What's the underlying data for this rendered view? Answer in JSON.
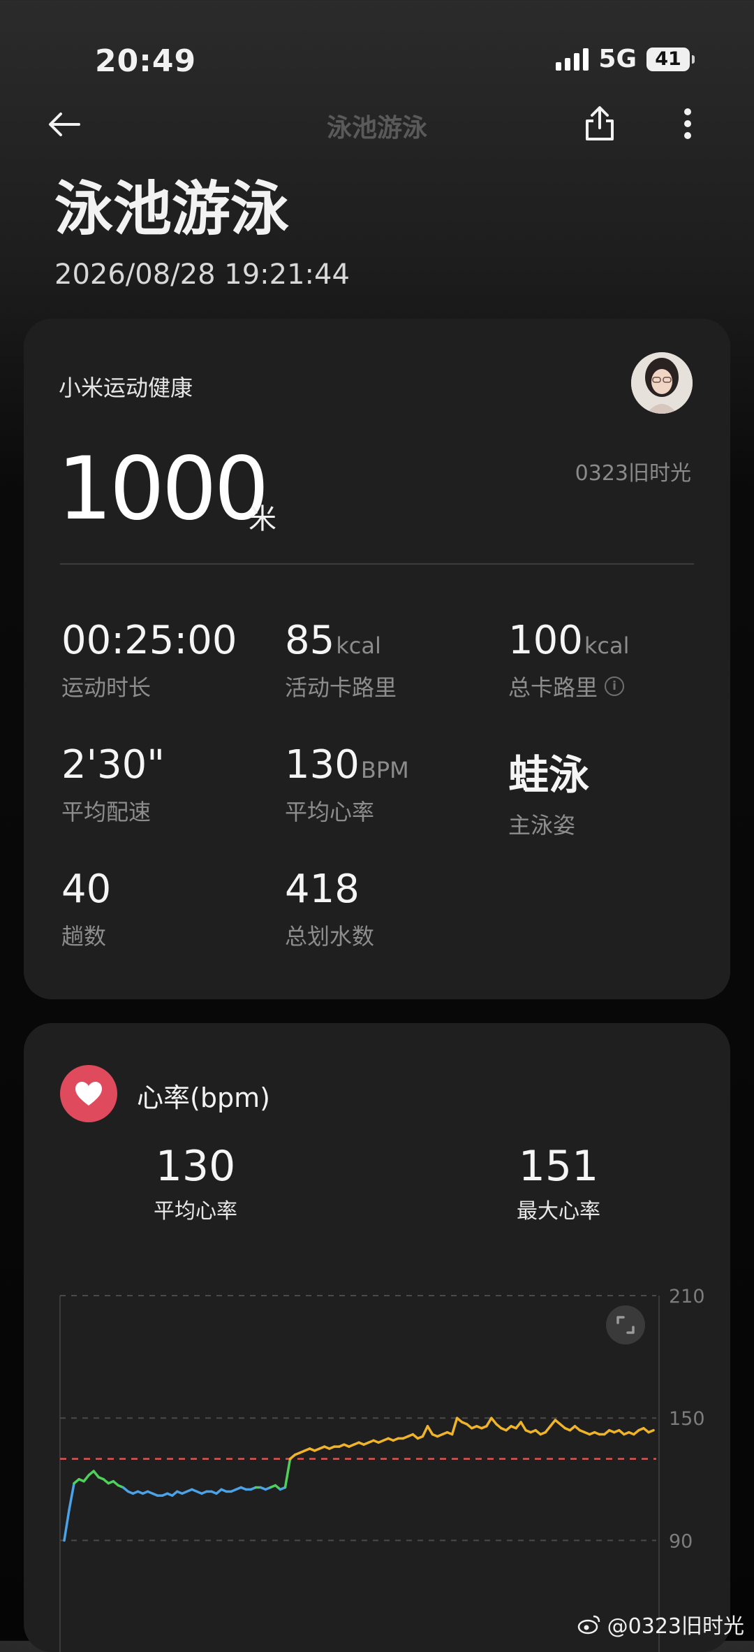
{
  "status_bar": {
    "time": "20:49",
    "network": "5G",
    "battery": "41"
  },
  "toolbar": {
    "title": "泳池游泳"
  },
  "header": {
    "title": "泳池游泳",
    "datetime": "2026/08/28 19:21:44"
  },
  "summary": {
    "app_name": "小米运动健康",
    "distance": "1000",
    "distance_unit": "米",
    "watermark": "0323旧时光",
    "stats": [
      {
        "value": "00:25:00",
        "unit": "",
        "label": "运动时长"
      },
      {
        "value": "85",
        "unit": "kcal",
        "label": "活动卡路里"
      },
      {
        "value": "100",
        "unit": "kcal",
        "label": "总卡路里",
        "info": true
      },
      {
        "value": "2'30\"",
        "unit": "",
        "label": "平均配速"
      },
      {
        "value": "130",
        "unit": "BPM",
        "label": "平均心率"
      },
      {
        "value": "蛙泳",
        "unit": "",
        "label": "主泳姿"
      },
      {
        "value": "40",
        "unit": "",
        "label": "趟数"
      },
      {
        "value": "418",
        "unit": "",
        "label": "总划水数"
      }
    ]
  },
  "heart_rate": {
    "title": "心率(bpm)",
    "avg_value": "130",
    "avg_label": "平均心率",
    "max_value": "151",
    "max_label": "最大心率"
  },
  "chart_data": {
    "type": "line",
    "title": "",
    "ylabel": "",
    "ylim": [
      70,
      210
    ],
    "yticks": [
      "210",
      "150",
      "90"
    ],
    "reference_line": 130,
    "grid": "dashed horizontal at 210, 150, 90",
    "series": [
      {
        "values": [
          90,
          105,
          118,
          120,
          119,
          122,
          124,
          121,
          120,
          118,
          119,
          117,
          116,
          114,
          113,
          114,
          113,
          114,
          113,
          112,
          112,
          113,
          112,
          114,
          113,
          114,
          115,
          114,
          113,
          114,
          114,
          113,
          115,
          114,
          114,
          115,
          116,
          115,
          115,
          116,
          116,
          115,
          116,
          117,
          115,
          116,
          130,
          132,
          133,
          134,
          135,
          134,
          135,
          136,
          135,
          136,
          136,
          137,
          136,
          137,
          138,
          137,
          138,
          139,
          138,
          139,
          140,
          139,
          140,
          140,
          141,
          142,
          140,
          141,
          146,
          142,
          141,
          142,
          143,
          142,
          150,
          148,
          147,
          145,
          146,
          145,
          146,
          150,
          147,
          145,
          144,
          146,
          145,
          148,
          144,
          143,
          144,
          142,
          143,
          146,
          149,
          147,
          145,
          144,
          146,
          144,
          143,
          142,
          143,
          142,
          142,
          144,
          143,
          144,
          142,
          143,
          142,
          144,
          145,
          143,
          144
        ]
      }
    ],
    "series_colors": {
      "low": "#4aa3e8",
      "mid": "#4fd05a",
      "high": "#f0b429"
    },
    "reference_color": "#e05555"
  },
  "watermark_bottom": "@0323旧时光",
  "colors": {
    "heart_badge": "#e04a5d",
    "card_bg": "#1f1f1f"
  }
}
